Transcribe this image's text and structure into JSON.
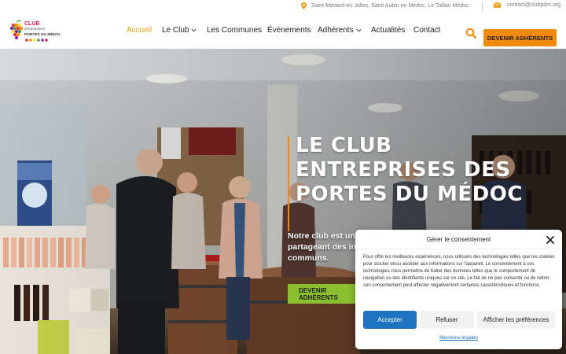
{
  "topbar": {
    "address": "Saint-Médard-en-Jalles, Saint Aubin en Médoc, Le Taillan Médoc",
    "email": "contact@clubpdm.org",
    "location_icon": "map-pin-icon",
    "mail_icon": "envelope-icon"
  },
  "logo": {
    "line1": "CLUB",
    "line2": "d'Entreprises",
    "line3": "PORTES DU MÉDOC"
  },
  "nav": {
    "items": [
      {
        "label": "Accueil",
        "active": true,
        "dropdown": false
      },
      {
        "label": "Le Club",
        "active": false,
        "dropdown": true
      },
      {
        "label": "Les Communes",
        "active": false,
        "dropdown": false
      },
      {
        "label": "Évènements",
        "active": false,
        "dropdown": false
      },
      {
        "label": "Adhérents",
        "active": false,
        "dropdown": true
      },
      {
        "label": "Actualités",
        "active": false,
        "dropdown": false
      },
      {
        "label": "Contact",
        "active": false,
        "dropdown": false
      }
    ],
    "cta": "Devenir adhérents"
  },
  "hero": {
    "title_lines": [
      "LE CLUB",
      "ENTREPRISES DES",
      "PORTES DU MÉDOC"
    ],
    "desc_lines": [
      "Notre club est une",
      "partageant des inté",
      "communs."
    ],
    "button": "Devenir adhérents"
  },
  "consent": {
    "title": "Gérer le consentement",
    "body": "Pour offrir les meilleures expériences, nous utilisons des technologies telles que les cookies pour stocker et/ou accéder aux informations sur l'appareil. Le consentement à ces technologies nous permettra de traiter des données telles que le comportement de navigation ou des identifiants uniques sur ce site. Le fait de ne pas consentir ou de retirer son consentement peut affecter négativement certaines caractéristiques et fonctions.",
    "accept": "Accepter",
    "refuse": "Refuser",
    "prefs": "Afficher les préférences",
    "legal": "Mentions légales"
  },
  "colors": {
    "accent_orange": "#f18a0b",
    "active_nav": "#e8a014",
    "hero_button": "#8bbf2f",
    "consent_blue": "#1e73be"
  }
}
